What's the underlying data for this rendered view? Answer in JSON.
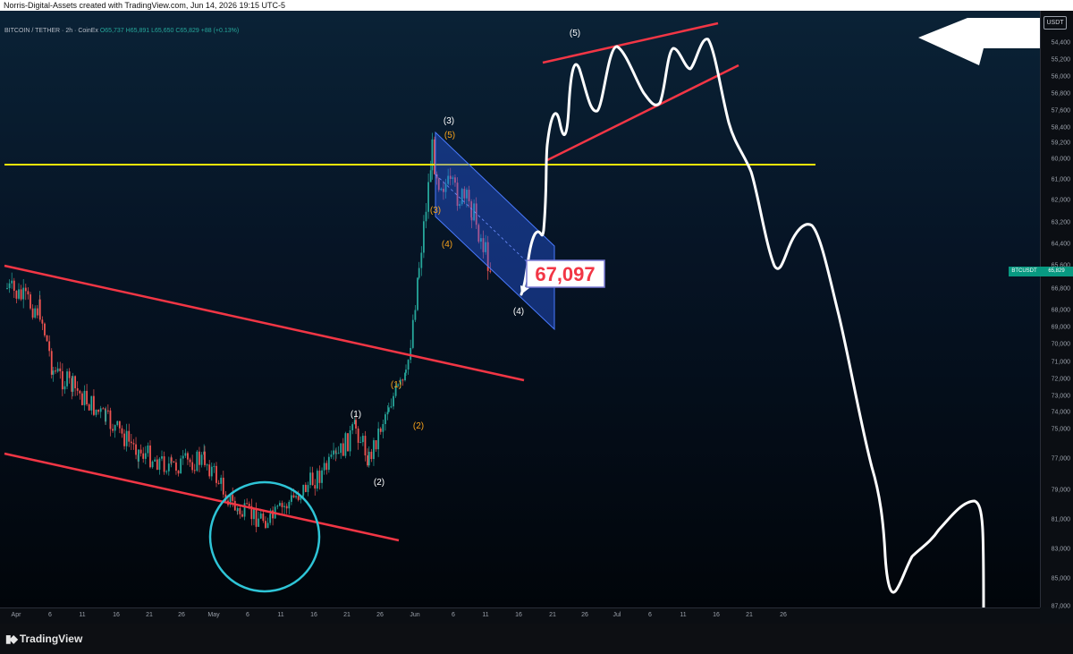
{
  "header": {
    "credit": "Norris-Digital-Assets created with TradingView.com, Jun 14, 2026 19:15 UTC-5"
  },
  "symbol": {
    "title": "BITCOIN / TETHER · 2h · CoinEx",
    "open": "O65,737",
    "high": "H65,891",
    "low": "L65,650",
    "close": "C65,829",
    "change": "+88 (+0.13%)"
  },
  "y_axis": {
    "unit": "USDT",
    "ticks": [
      "54,400",
      "55,200",
      "56,000",
      "56,800",
      "57,600",
      "58,400",
      "59,200",
      "60,000",
      "61,000",
      "62,000",
      "63,200",
      "64,400",
      "65,600",
      "66,800",
      "68,000",
      "69,000",
      "70,000",
      "71,000",
      "72,000",
      "73,000",
      "74,000",
      "75,000",
      "77,000",
      "79,000",
      "81,000",
      "83,000",
      "85,000",
      "87,000"
    ]
  },
  "x_axis": {
    "ticks": [
      "Apr",
      "6",
      "11",
      "16",
      "21",
      "26",
      "May",
      "6",
      "11",
      "16",
      "21",
      "26",
      "Jun",
      "6",
      "11",
      "16",
      "21",
      "26",
      "Jul",
      "6",
      "11",
      "16",
      "21",
      "26"
    ]
  },
  "last_price": {
    "symbol": "BTCUSDT",
    "value": "65,829"
  },
  "callout": {
    "value": "67,097"
  },
  "wave_labels": {
    "w1_white": "(1)",
    "w2_white": "(2)",
    "w3_white": "(3)",
    "w4_white": "(4)",
    "w5_white": "(5)",
    "w1_orange": "(1)",
    "w2_orange": "(2)",
    "w3_orange": "(3)",
    "w4_orange": "(4)",
    "w5_orange": "(5)"
  },
  "colors": {
    "candle_up": "#26a69a",
    "candle_down": "#ef5350",
    "trendline": "#f23645",
    "horizontal_level": "#f5e50a",
    "circle": "#2ec4d6",
    "flag_fill": "#2962ff",
    "projection": "#ffffff",
    "callout_text": "#f23645",
    "wave_orange": "#f7a21b"
  },
  "footer": {
    "brand": "TradingView"
  },
  "chart_data": {
    "type": "candlestick",
    "symbol": "BITCOIN / TETHER",
    "interval": "2h",
    "y_scale": "inverted (price increases downward)",
    "ylim": [
      54400,
      87000
    ],
    "x_range": [
      "Apr",
      "Jul 26"
    ],
    "anchors": [
      {
        "x": "Apr 1",
        "y": 66800
      },
      {
        "x": "Apr 6",
        "y": 68000
      },
      {
        "x": "Apr 8",
        "y": 71500
      },
      {
        "x": "Apr 11",
        "y": 72500
      },
      {
        "x": "Apr 16",
        "y": 74500
      },
      {
        "x": "Apr 21",
        "y": 76500
      },
      {
        "x": "Apr 26",
        "y": 77500
      },
      {
        "x": "May 1",
        "y": 77000
      },
      {
        "x": "May 6",
        "y": 80500
      },
      {
        "x": "May 11",
        "y": 81000
      },
      {
        "x": "May 16",
        "y": 79000
      },
      {
        "x": "May 21",
        "y": 77000
      },
      {
        "x": "May 24",
        "y": 75000
      },
      {
        "x": "May 26",
        "y": 77000
      },
      {
        "x": "May 29",
        "y": 73500
      },
      {
        "x": "Jun 1",
        "y": 72000
      },
      {
        "x": "Jun 3",
        "y": 65500
      },
      {
        "x": "Jun 5",
        "y": 59600
      },
      {
        "x": "Jun 6",
        "y": 61000
      },
      {
        "x": "Jun 11",
        "y": 62500
      },
      {
        "x": "Jun 14",
        "y": 65829
      }
    ],
    "horizontal_level": 60000,
    "projection_path": [
      {
        "x": "Jun 17",
        "y": 66800
      },
      {
        "x": "Jun 20",
        "y": 64200
      },
      {
        "x": "Jun 24",
        "y": 55400
      },
      {
        "x": "Jul 1",
        "y": 55200
      },
      {
        "x": "Jul 10",
        "y": 55300
      },
      {
        "x": "Jul 14",
        "y": 54500
      },
      {
        "x": "Jul 22",
        "y": 64800
      },
      {
        "x": "Jul 26",
        "y": 63300
      },
      {
        "x": "Aug",
        "y": 85000
      }
    ]
  }
}
